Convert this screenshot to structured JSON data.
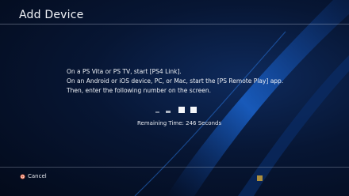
{
  "header": {
    "title": "Add Device"
  },
  "instructions": {
    "line1": "On a PS Vita or PS TV, start [PS4 Link].",
    "line2": "On an Android or iOS device, PC, or Mac, start the [PS Remote Play] app.",
    "line3": "Then, enter the following number on the screen."
  },
  "timer": {
    "remaining_text": "Remaining Time: 246 Seconds",
    "seconds": 246
  },
  "footer": {
    "cancel_label": "Cancel",
    "cancel_icon": "circle-button-icon"
  },
  "colors": {
    "background": "#071634",
    "accent_wave": "#1f6fd6",
    "cancel_icon": "#e05a3a",
    "indicator": "#c9a13a"
  }
}
